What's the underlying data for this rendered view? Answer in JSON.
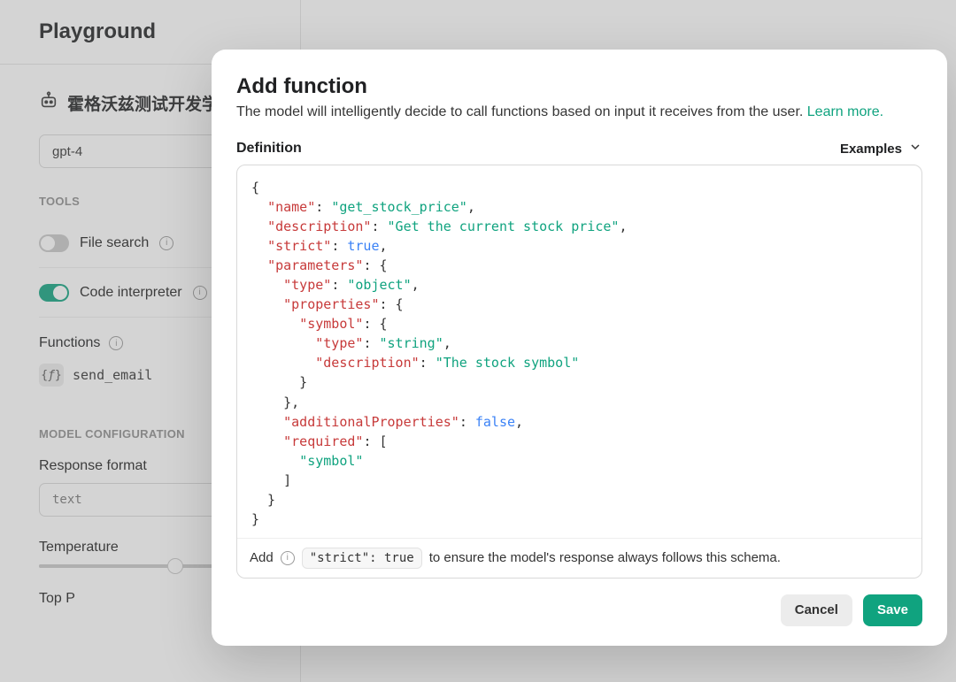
{
  "header": {
    "title": "Playground"
  },
  "assistant": {
    "name": "霍格沃兹测试开发学"
  },
  "model": {
    "selected": "gpt-4"
  },
  "tools": {
    "section_label": "TOOLS",
    "file_search": {
      "label": "File search",
      "enabled": false
    },
    "code_interpreter": {
      "label": "Code interpreter",
      "enabled": true
    }
  },
  "functions": {
    "label": "Functions",
    "items": [
      {
        "name": "send_email"
      }
    ]
  },
  "model_config": {
    "section_label": "MODEL CONFIGURATION",
    "response_format": {
      "label": "Response format",
      "value": "text"
    },
    "temperature": {
      "label": "Temperature",
      "value": 0.7
    },
    "top_p": {
      "label": "Top P"
    }
  },
  "modal": {
    "title": "Add function",
    "subtitle": "The model will intelligently decide to call functions based on input it receives from the user. ",
    "learn_more": "Learn more.",
    "definition_label": "Definition",
    "examples_label": "Examples",
    "strict_prefix": "Add",
    "strict_chip": "\"strict\": true",
    "strict_suffix": "to ensure the model's response always follows this schema.",
    "cancel_label": "Cancel",
    "save_label": "Save",
    "function_definition": {
      "name": "get_stock_price",
      "description": "Get the current stock price",
      "strict": true,
      "parameters": {
        "type": "object",
        "properties": {
          "symbol": {
            "type": "string",
            "description": "The stock symbol"
          }
        },
        "additionalProperties": false,
        "required": [
          "symbol"
        ]
      }
    }
  }
}
